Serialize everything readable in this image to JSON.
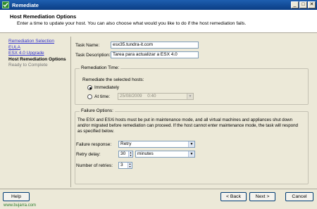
{
  "window": {
    "title": "Remediate"
  },
  "header": {
    "title": "Host Remediation Options",
    "subtitle": "Enter a time to update your host. You can also choose what would you like to do if the host remediation fails."
  },
  "nav": {
    "items": [
      {
        "label": "Remediation Selection"
      },
      {
        "label": "EULA"
      },
      {
        "label": "ESX 4.0 Upgrade"
      },
      {
        "label": "Host Remediation Options"
      },
      {
        "label": "Ready to Complete"
      }
    ]
  },
  "form": {
    "task_name_label": "Task Name:",
    "task_name_value": "esx35.tundra-it.com",
    "task_description_label": "Task Description:",
    "task_description_value": "Tarea para actualizar a ESX 4.0"
  },
  "remediation_time": {
    "legend": "Remediation Time:",
    "prompt": "Remediate the selected hosts:",
    "immediately_label": "Immediately",
    "at_time_label": "At time:",
    "date_value": "25/08/2009",
    "time_value": "0:40",
    "selected": "immediately"
  },
  "failure_options": {
    "legend": "Failure Options:",
    "description": "The ESX and ESXi hosts must be put in maintenance mode, and all virtual machines and appliances shut down and/or migrated before remediation can proceed.  If the host cannot enter maintenance mode, the task will respond as specified below.",
    "failure_response_label": "Failure response:",
    "failure_response_value": "Retry",
    "retry_delay_label": "Retry delay:",
    "retry_delay_value": "30",
    "retry_delay_unit": "minutes",
    "retries_label": "Number of retries:",
    "retries_value": "3"
  },
  "buttons": {
    "help": "Help",
    "back": "< Back",
    "next": "Next >",
    "cancel": "Cancel"
  },
  "watermark": "www.bujarra.com",
  "colors": {
    "titlebar": "#0a3d84",
    "link": "#3333cc",
    "panel": "#ece9d8"
  }
}
